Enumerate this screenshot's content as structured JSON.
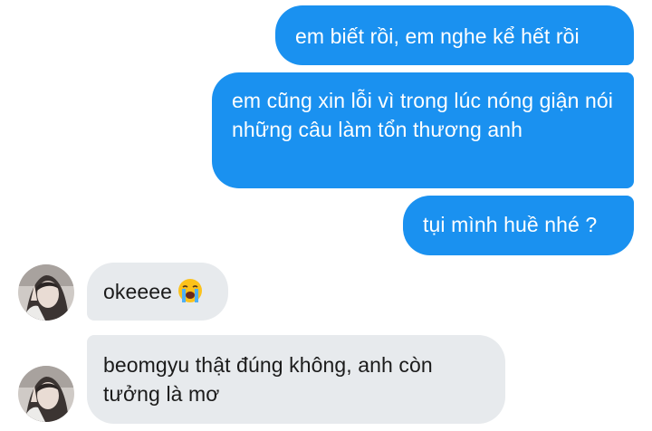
{
  "conversation": {
    "messages": [
      {
        "direction": "outgoing",
        "text": "em biết rồi, em nghe kể hết rồi"
      },
      {
        "direction": "outgoing",
        "text": "em cũng xin lỗi vì trong lúc nóng giận nói những câu làm tổn thương anh"
      },
      {
        "direction": "outgoing",
        "text": "tụi mình huề nhé ?"
      },
      {
        "direction": "incoming",
        "text": "okeeee",
        "emoji": "loudly-crying-face-icon"
      },
      {
        "direction": "incoming",
        "text": "beomgyu thật đúng không, anh còn tưởng là mơ"
      }
    ]
  },
  "colors": {
    "outgoing_bubble": "#1a91f0",
    "incoming_bubble": "#e7eaed",
    "outgoing_text": "#ffffff",
    "incoming_text": "#1b1b1b",
    "background": "#ffffff"
  }
}
